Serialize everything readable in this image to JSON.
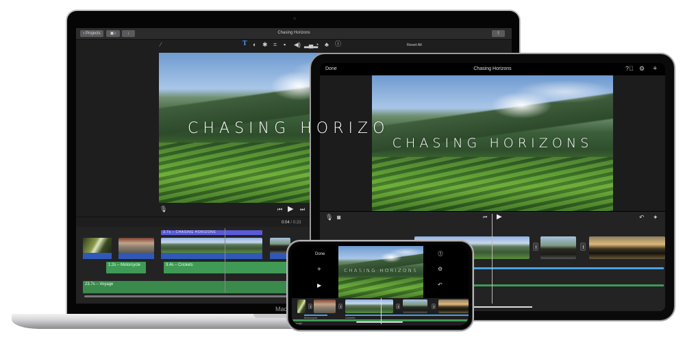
{
  "mac": {
    "toolbar": {
      "projects_label": "Projects",
      "title": "Chasing Horizons",
      "reset_label": "Reset All"
    },
    "adjust_icons": [
      "magic-wand-icon",
      "title-text-icon",
      "color-balance-icon",
      "color-palette-icon",
      "crop-icon",
      "camera-stabilize-icon",
      "volume-icon",
      "equalizer-icon",
      "speed-icon",
      "filter-icon",
      "info-icon"
    ],
    "viewer": {
      "title_text": "CHASING HORIZONS",
      "timecode_current": "0:04",
      "timecode_separator": "/",
      "timecode_total": "0:23"
    },
    "timeline": {
      "title_clip_label": "3.7s – CHASING HORIZONS",
      "audio_clips": [
        {
          "label": "1.2s – Motorcycle"
        },
        {
          "label": "9.4s – Crickets"
        }
      ],
      "music_clip_label": "23.7s – Voyage"
    },
    "brand_partial": "Mac",
    "colors": {
      "title_clip": "#5a5ad8",
      "video_track": "#2f58b8",
      "audio": "#3f9a55",
      "background": "#1e1e1f"
    }
  },
  "ipad": {
    "nav": {
      "done_label": "Done",
      "title": "Chasing Horizons"
    },
    "nav_icons": [
      "help-icon",
      "settings-icon",
      "add-icon"
    ],
    "viewer": {
      "title_text": "CHASING HORIZONS"
    },
    "controls_icons": [
      "microphone-icon",
      "camera-icon",
      "skip-back-icon",
      "play-icon",
      "undo-icon",
      "audio-waveform-icon"
    ],
    "colors": {
      "audio": "#4aa3df",
      "music": "#3f9a55"
    }
  },
  "iphone": {
    "done_label": "Done",
    "viewer": {
      "title_text": "CHASING HORIZONS"
    },
    "timeline": {
      "audio_labels": [
        "Motorcycle",
        "Crickets"
      ],
      "music_label": "Voyage"
    }
  }
}
